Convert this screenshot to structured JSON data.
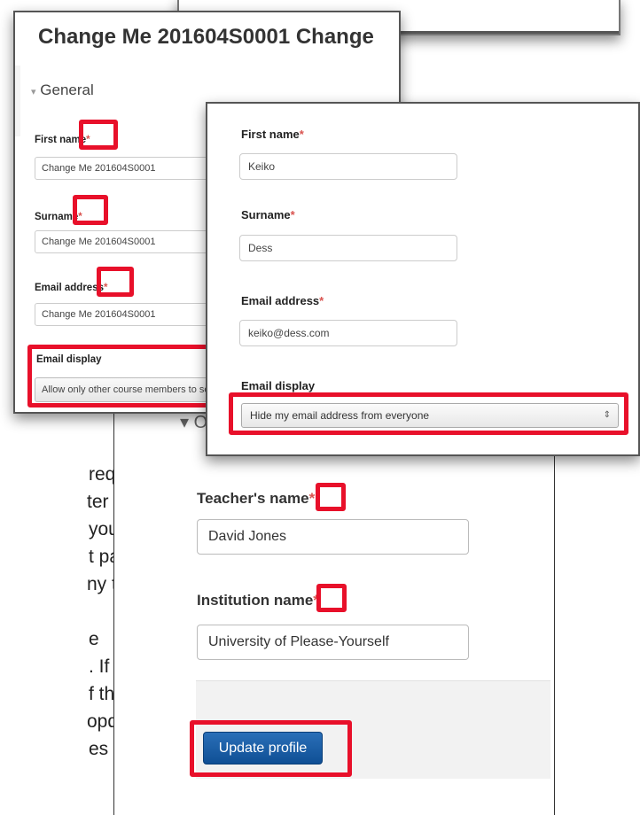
{
  "panel1": {
    "title": "Change Me 201604S0001 Change",
    "section": "General",
    "first_name_label": "First name",
    "first_name_value": "Change Me 201604S0001",
    "surname_label": "Surname",
    "surname_value": "Change Me 201604S0001",
    "email_label": "Email address",
    "email_value": "Change Me 201604S0001",
    "email_display_label": "Email display",
    "email_display_value": "Allow only other course members to see my email address",
    "required_mark": "*"
  },
  "panel2": {
    "first_name_label": "First name",
    "first_name_value": "Keiko",
    "surname_label": "Surname",
    "surname_value": "Dess",
    "email_label": "Email address",
    "email_value": "keiko@dess.com",
    "email_display_label": "Email display",
    "email_display_value": "Hide my email address from everyone",
    "required_mark": "*"
  },
  "panel3": {
    "section_partial": "O",
    "teacher_label": "Teacher's name",
    "teacher_value": "David Jones",
    "institution_label": "Institution name",
    "institution_value": "University of Please-Yourself",
    "required_mark": "*",
    "update_button": "Update profile"
  },
  "body_text": {
    "line1": "required",
    "line2": "ter it.",
    "line3": " you",
    "line4": "t page.",
    "line5": "ny time,",
    "line6": "e",
    "line7": ". If you",
    "line8": "f the",
    "line9": "opdown",
    "line10": "es"
  },
  "colors": {
    "highlight_red": "#e8102a",
    "required_red": "#d9534f",
    "button_blue": "#1a5ea6"
  }
}
